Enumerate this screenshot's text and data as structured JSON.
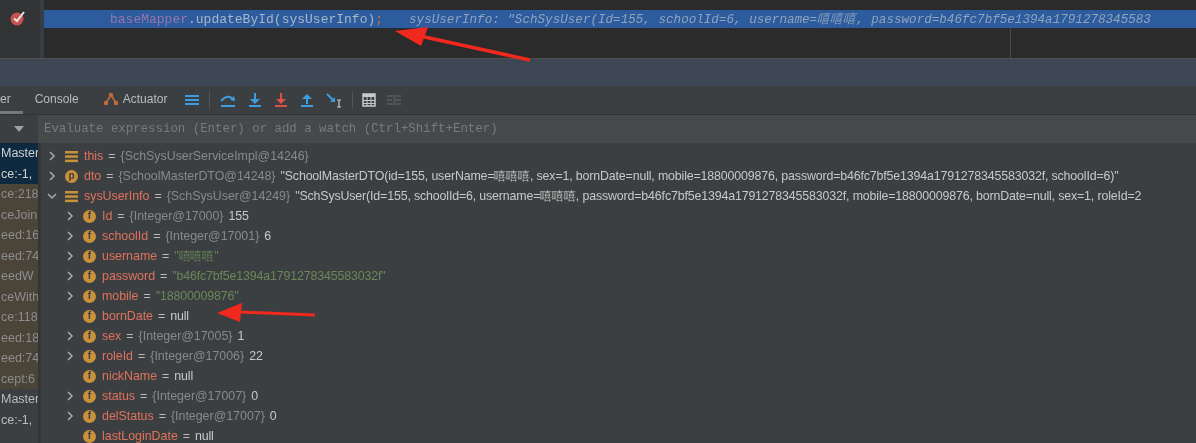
{
  "editor": {
    "code": {
      "object": "baseMapper",
      "call": ".updateById(sysUserInfo)",
      "end": ";"
    },
    "hint": "sysUserInfo: \"SchSysUser(Id=155, schoolId=6, username=嘻嘻嘻, password=b46fc7bf5e1394a1791278345583"
  },
  "tabs": [
    {
      "label": "er",
      "selected": true
    },
    {
      "label": "Console",
      "selected": false
    },
    {
      "label": "Actuator",
      "selected": false
    }
  ],
  "toolbar": [
    {
      "kind": "menu",
      "disabled": false
    },
    {
      "kind": "sep"
    },
    {
      "kind": "step-over",
      "disabled": false
    },
    {
      "kind": "step-into",
      "disabled": false
    },
    {
      "kind": "force-step-into",
      "disabled": false
    },
    {
      "kind": "step-out",
      "disabled": false
    },
    {
      "kind": "run-to-cursor",
      "disabled": false
    },
    {
      "kind": "sep"
    },
    {
      "kind": "evaluate",
      "disabled": false
    },
    {
      "kind": "trace",
      "disabled": true
    }
  ],
  "watch": {
    "placeholder": "Evaluate expression (Enter) or add a watch (Ctrl+Shift+Enter)"
  },
  "frames": [
    {
      "lines": [
        "Master",
        "ce:-1,"
      ],
      "selected": true,
      "library": false
    },
    {
      "lines": [
        "ce:218"
      ],
      "selected": false,
      "library": true
    },
    {
      "lines": [
        "ceJoin"
      ],
      "selected": false,
      "library": true
    },
    {
      "lines": [
        "eed:16"
      ],
      "selected": false,
      "library": true
    },
    {
      "lines": [
        "eed:74"
      ],
      "selected": false,
      "library": true
    },
    {
      "lines": [
        "eedW"
      ],
      "selected": false,
      "library": true
    },
    {
      "lines": [
        "ceWith"
      ],
      "selected": false,
      "library": true
    },
    {
      "lines": [
        "ce:118"
      ],
      "selected": false,
      "library": true
    },
    {
      "lines": [
        "eed:18"
      ],
      "selected": false,
      "library": true
    },
    {
      "lines": [
        "eed:74"
      ],
      "selected": false,
      "library": true
    },
    {
      "lines": [
        "cept:6"
      ],
      "selected": false,
      "library": true
    },
    {
      "lines": [
        "Master",
        "ce:-1,"
      ],
      "selected": false,
      "library": false
    }
  ],
  "variables": [
    {
      "name": "this",
      "op": "=",
      "kind": "object",
      "ref": "{SchSysUserServiceImpl@14246}",
      "expandable": true,
      "expanded": false
    },
    {
      "name": "dto",
      "op": "=",
      "kind": "param",
      "badge": "p",
      "ref": "{SchoolMasterDTO@14248}",
      "value": "\"SchoolMasterDTO(id=155, userName=嘻嘻嘻, sex=1, bornDate=null, mobile=18800009876, password=b46fc7bf5e1394a1791278345583032f, schoolId=6)\"",
      "expandable": true,
      "expanded": false
    },
    {
      "name": "sysUserInfo",
      "op": "=",
      "kind": "object",
      "ref": "{SchSysUser@14249}",
      "value": "\"SchSysUser(Id=155, schoolId=6, username=嘻嘻嘻, password=b46fc7bf5e1394a1791278345583032f, mobile=18800009876, bornDate=null, sex=1, roleId=2",
      "expandable": true,
      "expanded": true,
      "children": [
        {
          "name": "Id",
          "op": "=",
          "kind": "field",
          "badge": "f",
          "ref": "{Integer@17000}",
          "value": "155",
          "expandable": true,
          "expanded": false
        },
        {
          "name": "schoolId",
          "op": "=",
          "kind": "field",
          "badge": "f",
          "ref": "{Integer@17001}",
          "value": "6",
          "expandable": true,
          "expanded": false
        },
        {
          "name": "username",
          "op": "=",
          "kind": "text",
          "badge": "f",
          "value": "\"嘻嘻嘻\"",
          "expandable": true,
          "expanded": false
        },
        {
          "name": "password",
          "op": "=",
          "kind": "text",
          "badge": "f",
          "value": "\"b46fc7bf5e1394a1791278345583032f\"",
          "expandable": true,
          "expanded": false
        },
        {
          "name": "mobile",
          "op": "=",
          "kind": "text",
          "badge": "f",
          "value": "\"18800009876\"",
          "expandable": true,
          "expanded": false
        },
        {
          "name": "bornDate",
          "op": "=",
          "kind": "field",
          "badge": "f",
          "value": "null"
        },
        {
          "name": "sex",
          "op": "=",
          "kind": "field",
          "badge": "f",
          "ref": "{Integer@17005}",
          "value": "1",
          "expandable": true,
          "expanded": false
        },
        {
          "name": "roleId",
          "op": "=",
          "kind": "field",
          "badge": "f",
          "ref": "{Integer@17006}",
          "value": "22",
          "expandable": true,
          "expanded": false
        },
        {
          "name": "nickName",
          "op": "=",
          "kind": "field",
          "badge": "f",
          "value": "null"
        },
        {
          "name": "status",
          "op": "=",
          "kind": "field",
          "badge": "f",
          "ref": "{Integer@17007}",
          "value": "0",
          "expandable": true,
          "expanded": false
        },
        {
          "name": "delStatus",
          "op": "=",
          "kind": "field",
          "badge": "f",
          "ref": "{Integer@17007}",
          "value": "0",
          "expandable": true,
          "expanded": false
        },
        {
          "name": "lastLoginDate",
          "op": "=",
          "kind": "field",
          "badge": "f",
          "value": "null"
        }
      ]
    }
  ]
}
